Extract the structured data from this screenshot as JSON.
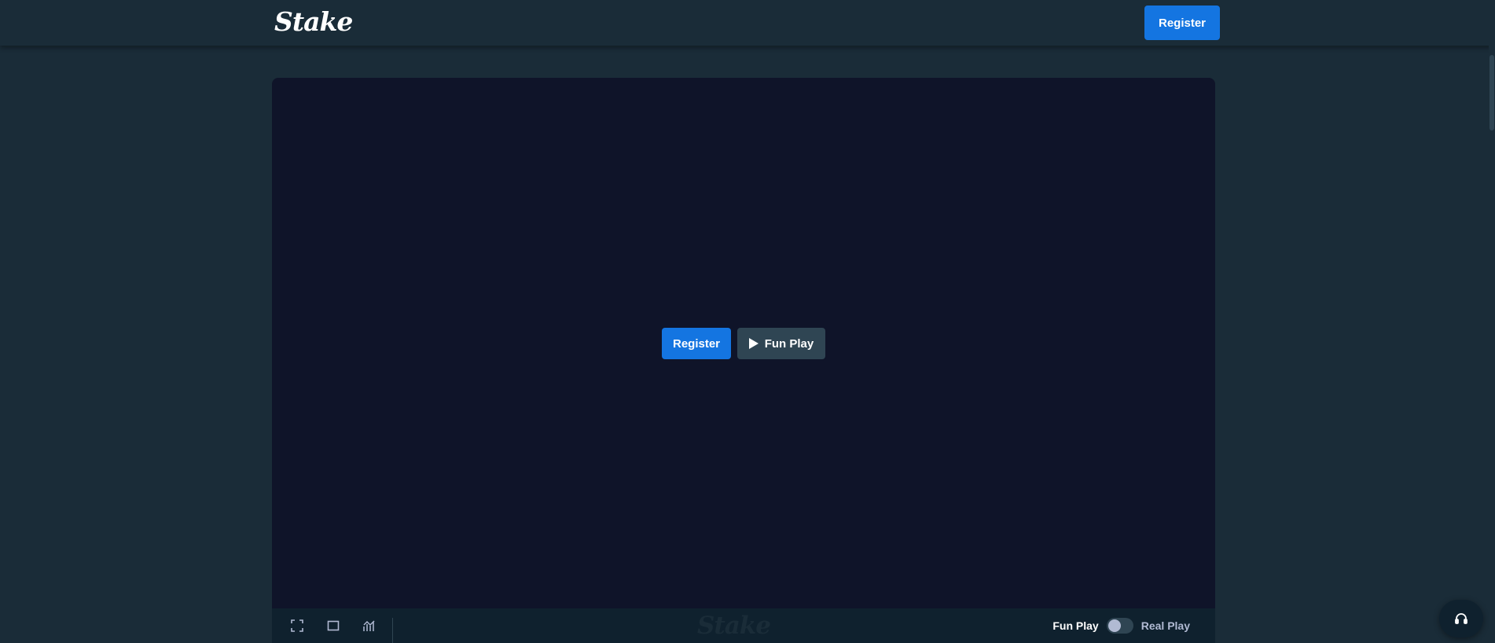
{
  "brand": {
    "name": "Stake"
  },
  "header": {
    "register_label": "Register"
  },
  "game": {
    "register_label": "Register",
    "fun_play_label": "Fun Play"
  },
  "footer": {
    "icons": [
      "fullscreen-icon",
      "theatre-mode-icon",
      "stats-icon"
    ],
    "brand_watermark": "Stake",
    "fun_play_label": "Fun Play",
    "real_play_label": "Real Play",
    "real_play_enabled": false
  },
  "support": {
    "icon": "headset-icon"
  },
  "colors": {
    "background": "#1a2c38",
    "game_area": "#0f1429",
    "footer": "#0f212e",
    "primary_button": "#1475e1",
    "secondary_button": "#2f4553"
  }
}
